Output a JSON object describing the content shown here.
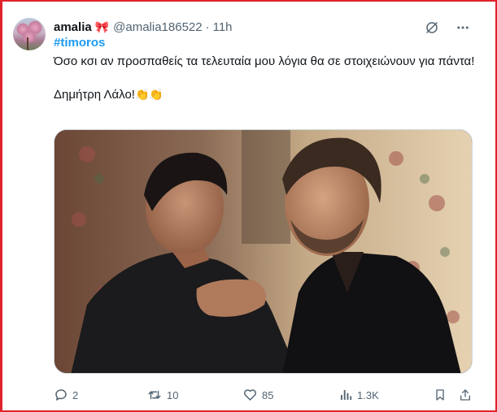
{
  "tweet": {
    "author_name": "amalia",
    "author_badge_emoji": "🎀",
    "handle": "@amalia186522",
    "separator": "·",
    "time": "11h",
    "hashtag": "#timoros",
    "text_line1": "Όσο κσι αν προσπαθείς τα τελευταία μου λόγια θα σε στοιχειώνουν για πάντα!",
    "text_line2": "Δημήτρη Λάλο!",
    "text_emoji": "👏👏"
  },
  "actions": {
    "replies": "2",
    "reposts": "10",
    "likes": "85",
    "views": "1.3K"
  },
  "icons": {
    "grok": "grok-icon",
    "more": "more-icon",
    "reply": "reply-icon",
    "repost": "repost-icon",
    "like": "heart-icon",
    "views": "views-icon",
    "bookmark": "bookmark-icon",
    "share": "share-icon"
  },
  "colors": {
    "hashtag": "#1d9bf0",
    "secondary_text": "#536471",
    "frame_border": "#e0232a"
  }
}
